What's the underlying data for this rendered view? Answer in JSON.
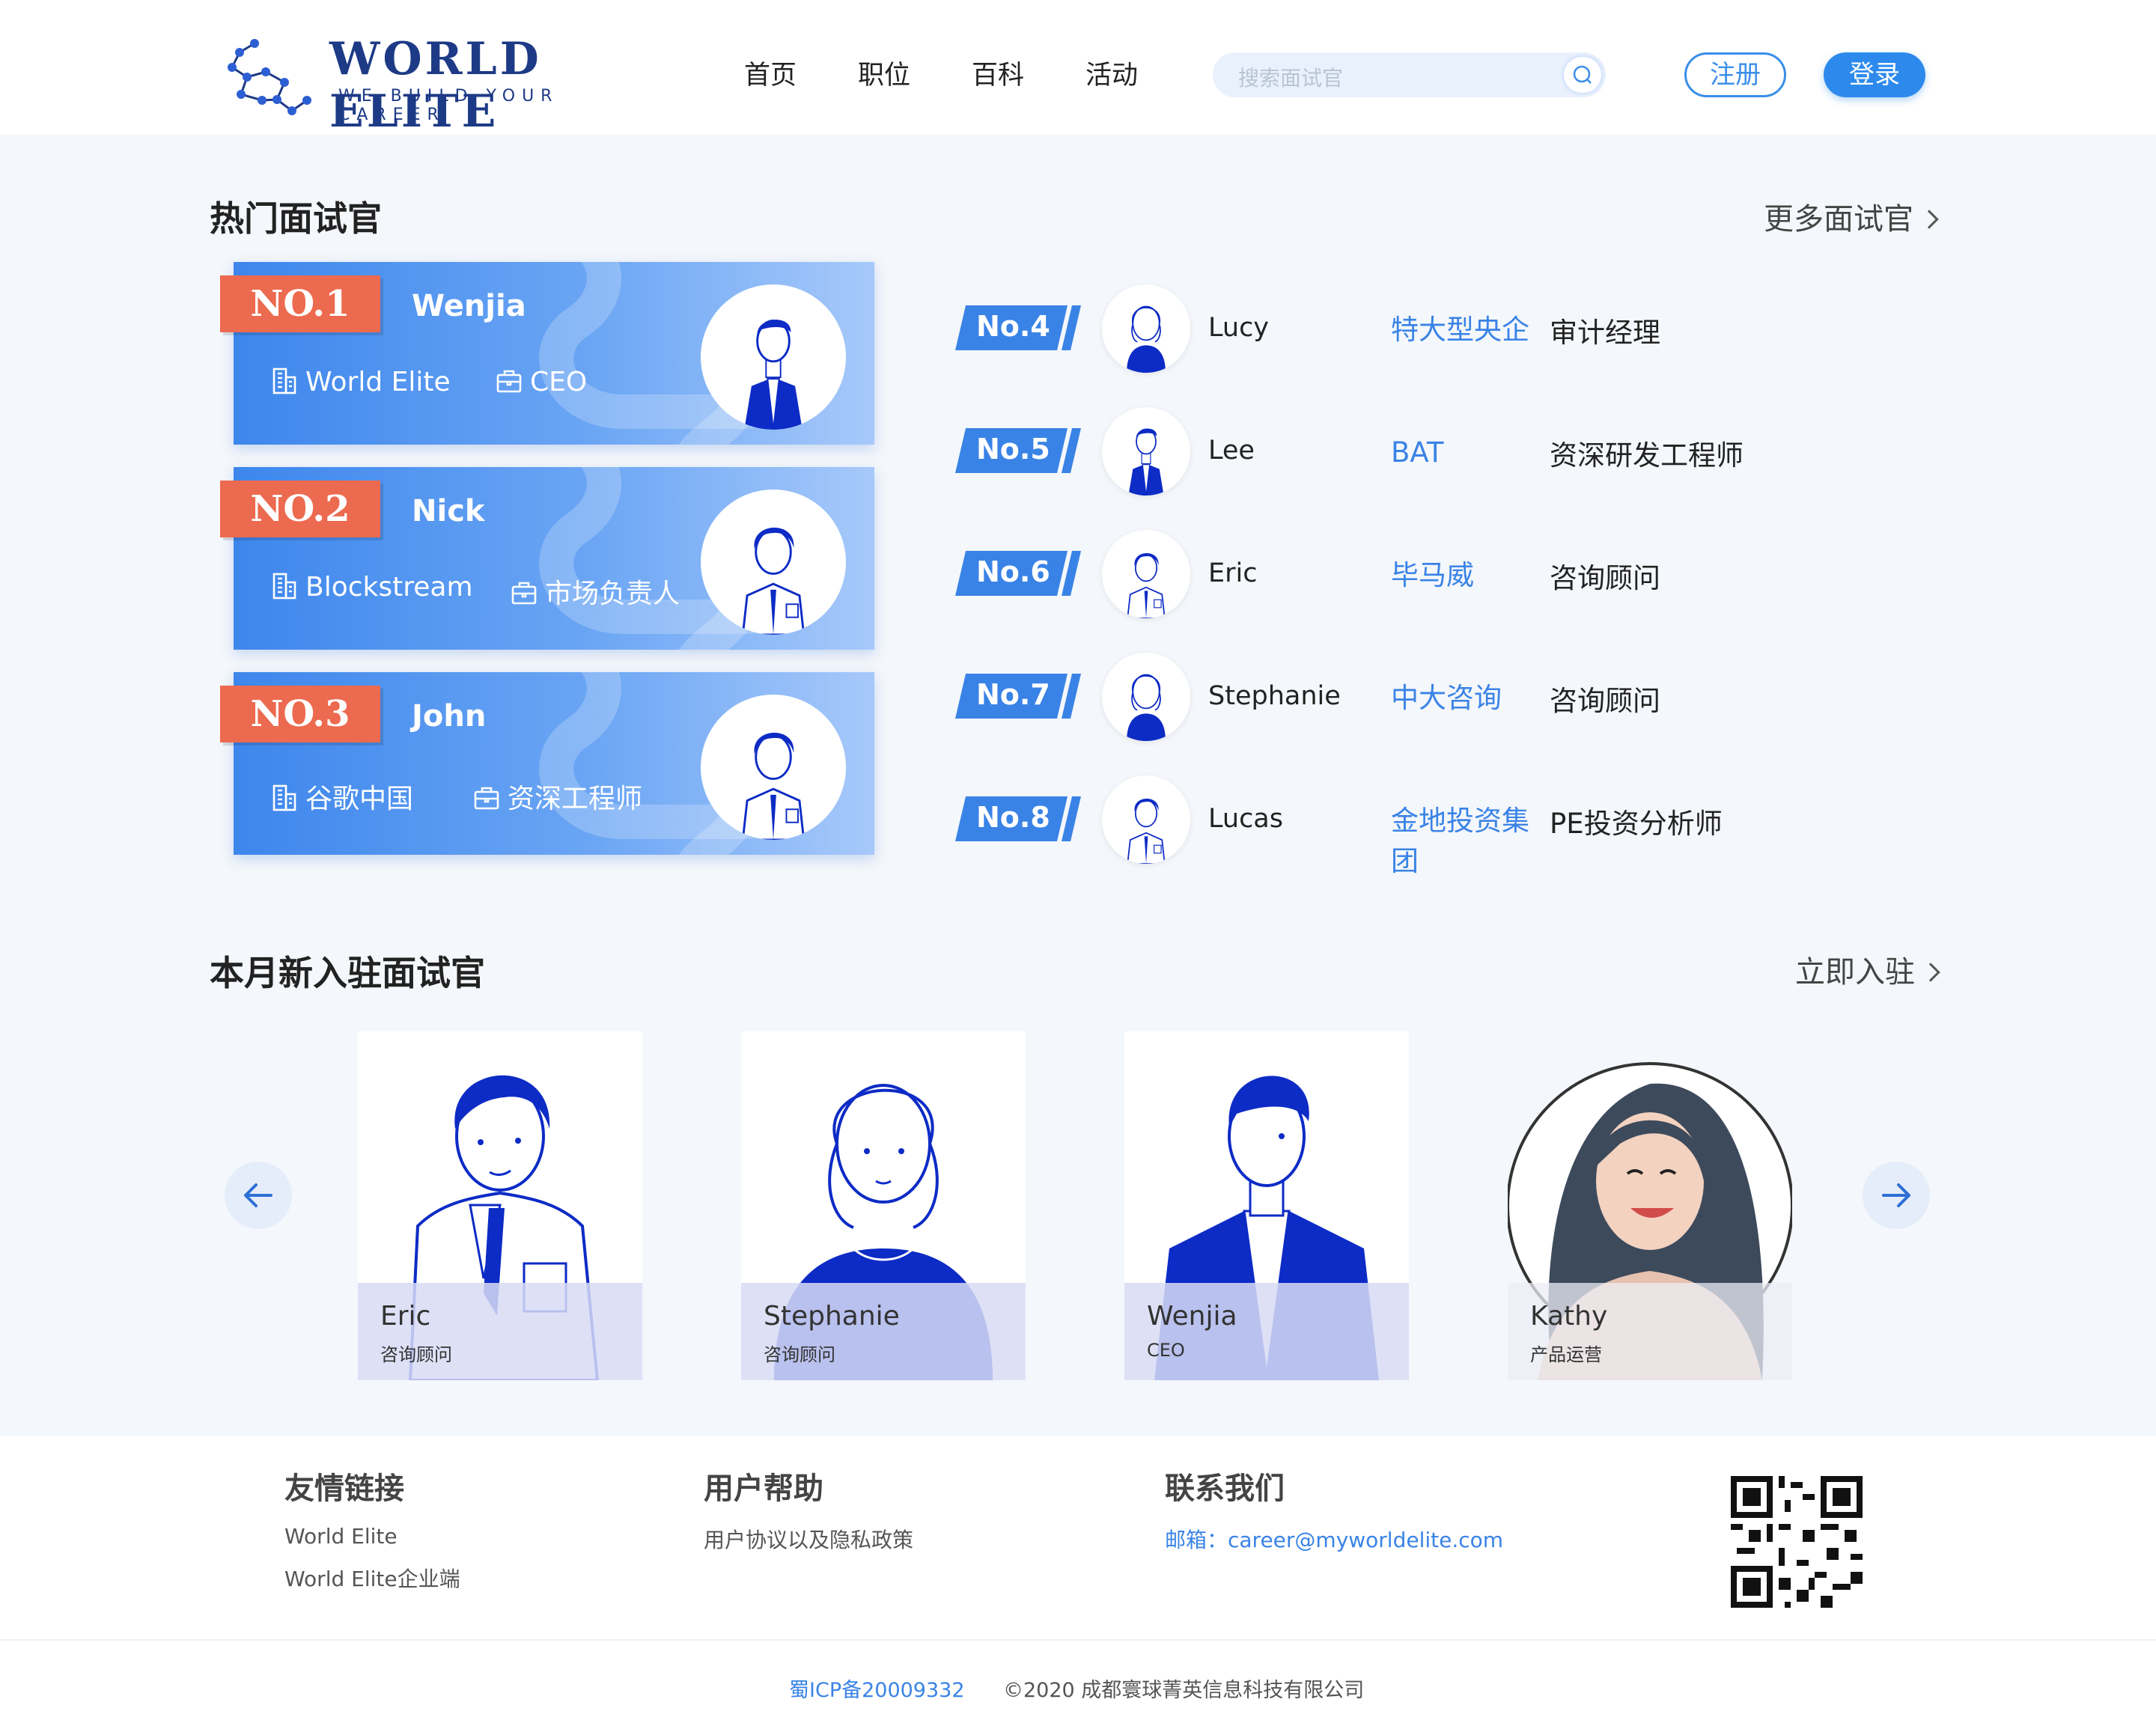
{
  "brand": {
    "name": "WORLD ELITE",
    "slogan": "WE BUILD YOUR CAREER"
  },
  "nav": [
    "首页",
    "职位",
    "百科",
    "活动"
  ],
  "search": {
    "placeholder": "搜索面试官"
  },
  "auth": {
    "register": "注册",
    "login": "登录"
  },
  "hot": {
    "title": "热门面试官",
    "more": "更多面试官",
    "top": [
      {
        "badge": "NO.1",
        "name": "Wenjia",
        "org": "World Elite",
        "role": "CEO"
      },
      {
        "badge": "NO.2",
        "name": "Nick",
        "org": "Blockstream",
        "role": "市场负责人"
      },
      {
        "badge": "NO.3",
        "name": "John",
        "org": "谷歌中国",
        "role": "资深工程师"
      }
    ],
    "list": [
      {
        "no": "No.4",
        "name": "Lucy",
        "company": "特大型央企",
        "role": "审计经理"
      },
      {
        "no": "No.5",
        "name": "Lee",
        "company": "BAT",
        "role": "资深研发工程师"
      },
      {
        "no": "No.6",
        "name": "Eric",
        "company": "毕马威",
        "role": "咨询顾问"
      },
      {
        "no": "No.7",
        "name": "Stephanie",
        "company": "中大咨询",
        "role": "咨询顾问"
      },
      {
        "no": "No.8",
        "name": "Lucas",
        "company": "金地投资集团",
        "role": "PE投资分析师"
      }
    ]
  },
  "newcomers": {
    "title": "本月新入驻面试官",
    "more": "立即入驻",
    "cards": [
      {
        "name": "Eric",
        "role": "咨询顾问"
      },
      {
        "name": "Stephanie",
        "role": "咨询顾问"
      },
      {
        "name": "Wenjia",
        "role": "CEO"
      },
      {
        "name": "Kathy",
        "role": "产品运营"
      }
    ]
  },
  "footer": {
    "friends": {
      "title": "友情链接",
      "links": [
        "World Elite",
        "World Elite企业端"
      ]
    },
    "help": {
      "title": "用户帮助",
      "links": [
        "用户协议以及隐私政策"
      ]
    },
    "contact": {
      "title": "联系我们",
      "email": "邮箱：career@myworldelite.com"
    },
    "icp": "蜀ICP备20009332",
    "copyright": "©2020 成都寰球菁英信息科技有限公司"
  },
  "colors": {
    "primary": "#2d8aec",
    "badge": "#ec6a4f",
    "ink": "#0d2bc5"
  }
}
